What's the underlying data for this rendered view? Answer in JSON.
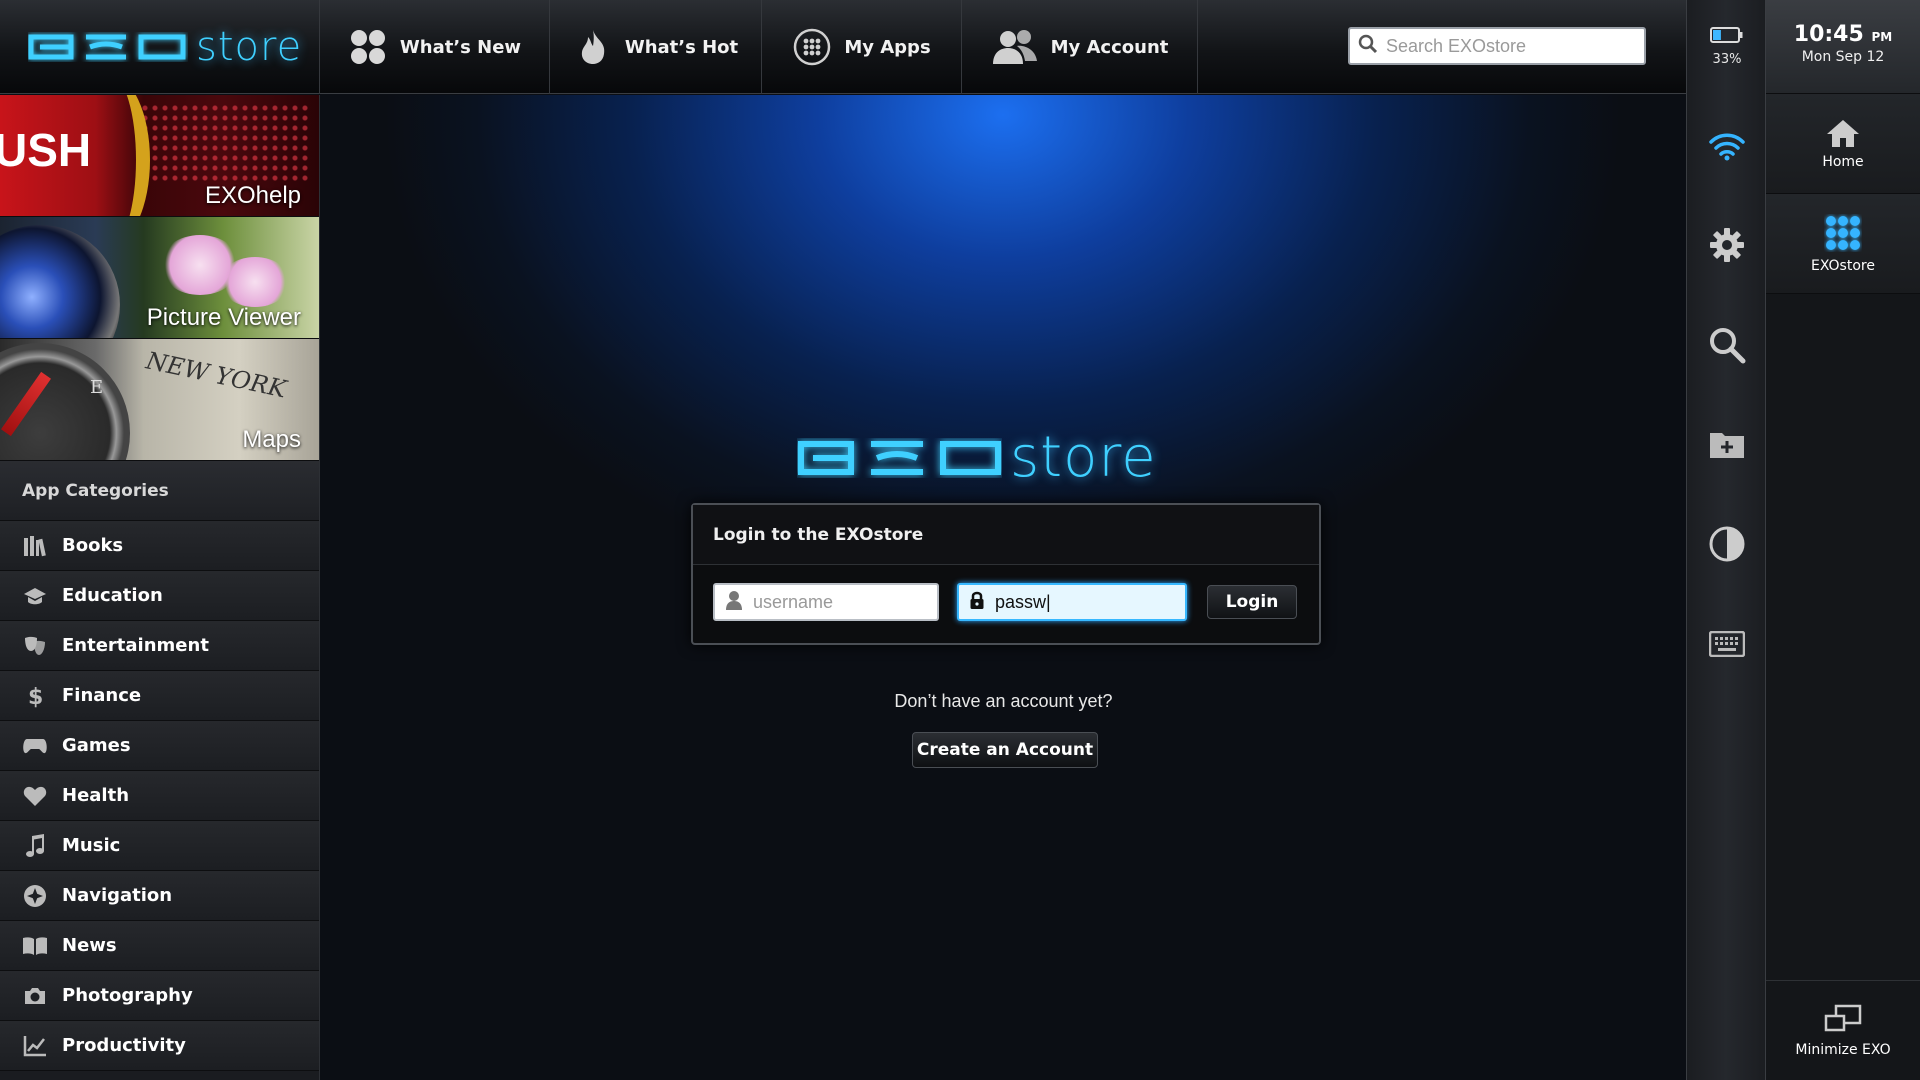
{
  "brand": {
    "logo_word": "store"
  },
  "nav": {
    "tabs": [
      {
        "label": "What’s New",
        "icon": "four-dots-icon"
      },
      {
        "label": "What’s Hot",
        "icon": "flame-icon"
      },
      {
        "label": "My Apps",
        "icon": "apps-grid-icon"
      },
      {
        "label": "My Account",
        "icon": "users-icon"
      }
    ]
  },
  "search": {
    "placeholder": "Search EXOstore",
    "value": ""
  },
  "featured": [
    {
      "label": "EXOhelp",
      "art_text": "USH"
    },
    {
      "label": "Picture Viewer"
    },
    {
      "label": "Maps",
      "art_text": "NEW YORK",
      "compass_letter": "E"
    }
  ],
  "categories": {
    "header": "App Categories",
    "items": [
      {
        "label": "Books",
        "icon": "books-icon"
      },
      {
        "label": "Education",
        "icon": "graduation-cap-icon"
      },
      {
        "label": "Entertainment",
        "icon": "theater-masks-icon"
      },
      {
        "label": "Finance",
        "icon": "dollar-icon"
      },
      {
        "label": "Games",
        "icon": "gamepad-icon"
      },
      {
        "label": "Health",
        "icon": "heart-icon"
      },
      {
        "label": "Music",
        "icon": "music-note-icon"
      },
      {
        "label": "Navigation",
        "icon": "compass-icon"
      },
      {
        "label": "News",
        "icon": "open-book-icon"
      },
      {
        "label": "Photography",
        "icon": "camera-icon"
      },
      {
        "label": "Productivity",
        "icon": "chart-line-icon"
      }
    ]
  },
  "login": {
    "logo_word": "store",
    "title": "Login to the EXOstore",
    "username_placeholder": "username",
    "username_value": "",
    "password_value": "passw|",
    "login_label": "Login",
    "no_account_text": "Don’t have an account yet?",
    "create_label": "Create an Account"
  },
  "system": {
    "battery_pct": "33%",
    "battery_level": 0.33,
    "icons": [
      "wifi-icon",
      "gear-icon",
      "search-icon",
      "folder-add-icon",
      "contrast-icon",
      "keyboard-icon"
    ]
  },
  "dock": {
    "time": "10:45",
    "ampm": "PM",
    "date": "Mon Sep 12",
    "home_label": "Home",
    "store_label": "EXOstore",
    "minimize_label": "Minimize EXO"
  },
  "colors": {
    "accent": "#3fd0ff",
    "field_focus": "#37b8ff"
  }
}
